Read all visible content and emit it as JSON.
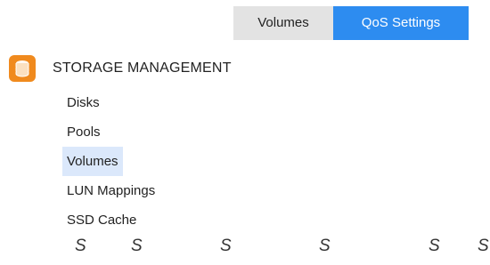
{
  "tabs": [
    {
      "label": "Volumes",
      "active": false
    },
    {
      "label": "QoS Settings",
      "active": true
    }
  ],
  "section": {
    "icon": "storage-icon",
    "title": "STORAGE MANAGEMENT"
  },
  "nav": {
    "items": [
      {
        "label": "Disks",
        "selected": false
      },
      {
        "label": "Pools",
        "selected": false
      },
      {
        "label": "Volumes",
        "selected": true
      },
      {
        "label": "LUN Mappings",
        "selected": false
      },
      {
        "label": "SSD Cache",
        "selected": false
      }
    ]
  },
  "footer": {
    "glyphs": [
      "S",
      "S",
      "S",
      "S",
      "S",
      "S"
    ]
  },
  "colors": {
    "accent": "#2d8cf0",
    "tab_inactive": "#e3e3e3",
    "selected_bg": "#dbe8fb",
    "icon_bg": "#f08a1e"
  }
}
